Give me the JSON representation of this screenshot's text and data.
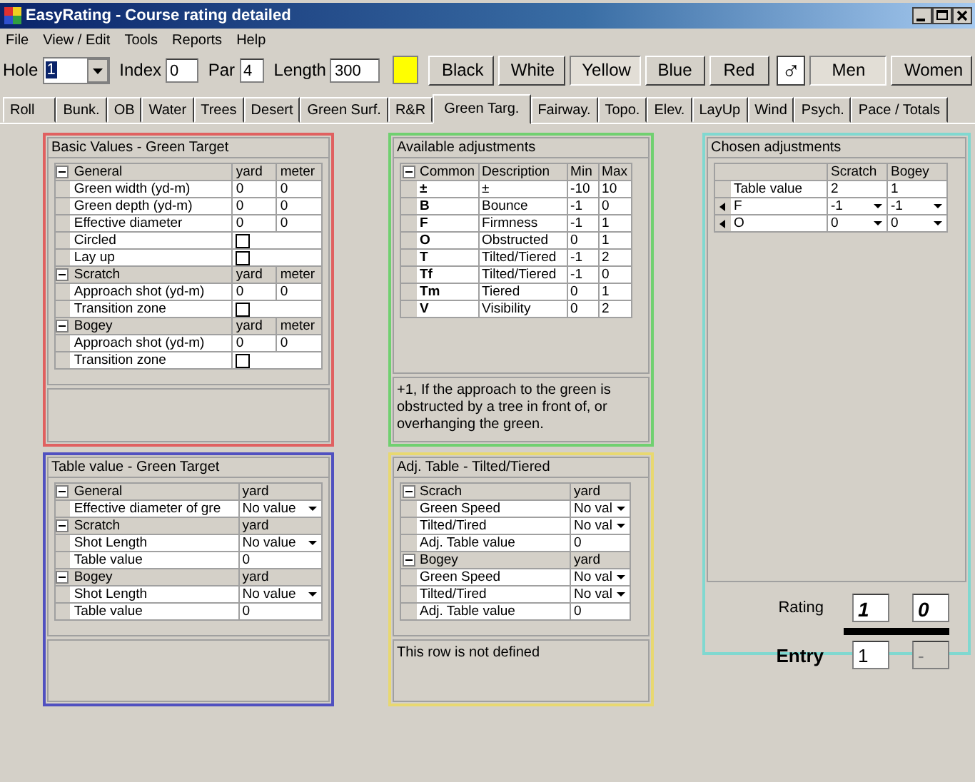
{
  "window": {
    "title": "EasyRating - Course rating detailed"
  },
  "menu": [
    "File",
    "View / Edit",
    "Tools",
    "Reports",
    "Help"
  ],
  "toolbar": {
    "hole_label": "Hole",
    "hole": "1",
    "index_label": "Index",
    "index": "0",
    "par_label": "Par",
    "par": "4",
    "length_label": "Length",
    "length": "300",
    "swatch": {
      "color": "#ffff00"
    },
    "tees": [
      {
        "label": "Black",
        "selected": false
      },
      {
        "label": "White",
        "selected": false
      },
      {
        "label": "Yellow",
        "selected": true
      },
      {
        "label": "Blue",
        "selected": false
      },
      {
        "label": "Red",
        "selected": false
      }
    ],
    "gender_symbol": "♂",
    "genders": [
      {
        "label": "Men",
        "selected": true
      },
      {
        "label": "Women",
        "selected": false
      }
    ]
  },
  "tabs": [
    {
      "label": "Roll",
      "selected": false
    },
    {
      "label": "Bunk.",
      "selected": false
    },
    {
      "label": "OB",
      "selected": false
    },
    {
      "label": "Water",
      "selected": false
    },
    {
      "label": "Trees",
      "selected": false
    },
    {
      "label": "Desert",
      "selected": false
    },
    {
      "label": "Green Surf.",
      "selected": false
    },
    {
      "label": "R&R",
      "selected": false
    },
    {
      "label": "Green Targ.",
      "selected": true
    },
    {
      "label": "Fairway.",
      "selected": false
    },
    {
      "label": "Topo.",
      "selected": false
    },
    {
      "label": "Elev.",
      "selected": false
    },
    {
      "label": "LayUp",
      "selected": false
    },
    {
      "label": "Wind",
      "selected": false
    },
    {
      "label": "Psych.",
      "selected": false
    },
    {
      "label": "Pace / Totals",
      "selected": false
    }
  ],
  "basic_values": {
    "title": "Basic Values - Green Target",
    "sections": [
      {
        "name": "General",
        "expanded": true,
        "headers": [
          "yard",
          "meter"
        ],
        "rows": [
          {
            "label": "Green width (yd-m)",
            "kind": "values",
            "values": [
              "0",
              "0"
            ]
          },
          {
            "label": "Green depth (yd-m)",
            "kind": "values",
            "values": [
              "0",
              "0"
            ]
          },
          {
            "label": "Effective diameter",
            "kind": "values",
            "values": [
              "0",
              "0"
            ]
          },
          {
            "label": "Circled",
            "kind": "checkbox",
            "checked": false
          },
          {
            "label": "Lay up",
            "kind": "checkbox",
            "checked": false
          }
        ]
      },
      {
        "name": "Scratch",
        "expanded": true,
        "headers": [
          "yard",
          "meter"
        ],
        "rows": [
          {
            "label": "Approach shot (yd-m)",
            "kind": "values",
            "values": [
              "0",
              "0"
            ]
          },
          {
            "label": "Transition zone",
            "kind": "checkbox",
            "checked": false
          }
        ]
      },
      {
        "name": "Bogey",
        "expanded": true,
        "headers": [
          "yard",
          "meter"
        ],
        "rows": [
          {
            "label": "Approach shot (yd-m)",
            "kind": "values",
            "values": [
              "0",
              "0"
            ]
          },
          {
            "label": "Transition zone",
            "kind": "checkbox",
            "checked": false
          }
        ]
      }
    ]
  },
  "table_value": {
    "title": "Table value - Green Target",
    "sections": [
      {
        "name": "General",
        "expanded": true,
        "headers": [
          "yard"
        ],
        "rows": [
          {
            "label": "Effective  diameter  of gre",
            "kind": "dropdown",
            "values": [
              "No value"
            ]
          }
        ]
      },
      {
        "name": "Scratch",
        "expanded": true,
        "headers": [
          "yard"
        ],
        "rows": [
          {
            "label": "Shot Length",
            "kind": "dropdown",
            "values": [
              "No value"
            ]
          },
          {
            "label": "Table value",
            "kind": "values",
            "values": [
              "0"
            ]
          }
        ]
      },
      {
        "name": "Bogey",
        "expanded": true,
        "headers": [
          "yard"
        ],
        "rows": [
          {
            "label": "Shot Length",
            "kind": "dropdown",
            "values": [
              "No value"
            ]
          },
          {
            "label": "Table value",
            "kind": "values",
            "values": [
              "0"
            ]
          }
        ]
      }
    ]
  },
  "available_adjustments": {
    "title": "Available adjustments",
    "expanded": true,
    "columns": [
      "Common",
      "Description",
      "Min",
      "Max"
    ],
    "rows": [
      [
        "±",
        "±",
        "-10",
        "10"
      ],
      [
        "B",
        "Bounce",
        "-1",
        "0"
      ],
      [
        "F",
        "Firmness",
        "-1",
        "1"
      ],
      [
        "O",
        "Obstructed",
        "0",
        "1"
      ],
      [
        "T",
        "Tilted/Tiered",
        "-1",
        "2"
      ],
      [
        "Tf",
        "Tilted/Tiered",
        "-1",
        "0"
      ],
      [
        "Tm",
        "Tiered",
        "0",
        "1"
      ],
      [
        "V",
        "Visibility",
        "0",
        "2"
      ]
    ],
    "note": "+1, If the approach to the green is obstructed by a tree in front of, or overhanging the green."
  },
  "adj_table": {
    "title": "Adj. Table - Tilted/Tiered",
    "sections": [
      {
        "name": "Scrach",
        "expanded": true,
        "headers": [
          "yard"
        ],
        "rows": [
          {
            "label": "Green Speed",
            "kind": "dropdown",
            "values": [
              "No val"
            ]
          },
          {
            "label": "Tilted/Tired",
            "kind": "dropdown",
            "values": [
              "No val"
            ]
          },
          {
            "label": "Adj. Table value",
            "kind": "values",
            "values": [
              "0"
            ]
          }
        ]
      },
      {
        "name": "Bogey",
        "expanded": true,
        "headers": [
          "yard"
        ],
        "rows": [
          {
            "label": "Green Speed",
            "kind": "dropdown",
            "values": [
              "No val"
            ]
          },
          {
            "label": "Tilted/Tired",
            "kind": "dropdown",
            "values": [
              "No val"
            ]
          },
          {
            "label": "Adj. Table value",
            "kind": "values",
            "values": [
              "0"
            ]
          }
        ]
      }
    ],
    "note": "This row is not defined"
  },
  "chosen_adjustments": {
    "title": "Chosen adjustments",
    "columns": [
      "Scratch",
      "Bogey"
    ],
    "rows": [
      {
        "label": "Table value",
        "marked": false,
        "kind": "values",
        "values": [
          "2",
          "1"
        ]
      },
      {
        "label": "F",
        "marked": true,
        "kind": "dropdown",
        "values": [
          "-1",
          "-1"
        ]
      },
      {
        "label": "O",
        "marked": true,
        "kind": "dropdown",
        "values": [
          "0",
          "0"
        ]
      }
    ]
  },
  "rating": {
    "label": "Rating",
    "values": [
      "1",
      "0"
    ],
    "entry_label": "Entry",
    "entry": [
      "1",
      "-"
    ]
  }
}
